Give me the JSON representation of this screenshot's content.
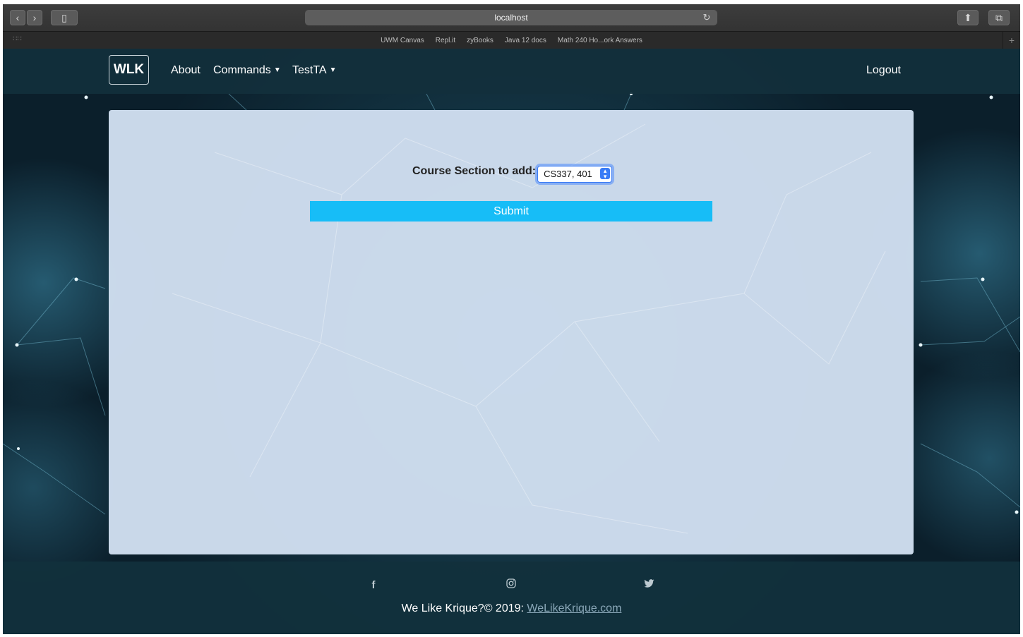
{
  "browser": {
    "url": "localhost",
    "favorites": [
      "UWM Canvas",
      "Repl.it",
      "zyBooks",
      "Java 12 docs",
      "Math 240 Ho...ork Answers"
    ],
    "icons": {
      "back": "chevron-left-icon",
      "forward": "chevron-right-icon",
      "sidebar": "sidebar-icon",
      "reload": "reload-icon",
      "share": "share-icon",
      "tabs": "tabs-icon",
      "favorites_grid": "grid-icon",
      "new_tab": "plus-icon"
    }
  },
  "navbar": {
    "brand": "WLK",
    "links": [
      "About",
      "Commands",
      "TestTA"
    ],
    "logout": "Logout"
  },
  "form": {
    "label": "Course Section to add:",
    "select_value": "CS337, 401",
    "submit_label": "Submit"
  },
  "footer": {
    "social_icons": [
      "facebook-icon",
      "instagram-icon",
      "twitter-icon"
    ],
    "copyright": "We Like Krique?© 2019: ",
    "link": "WeLikeKrique.com"
  },
  "colors": {
    "navbar": "#12303c",
    "card": "#d0def0",
    "submit": "#17bdf7",
    "select_focus": "#3b7cf5"
  }
}
